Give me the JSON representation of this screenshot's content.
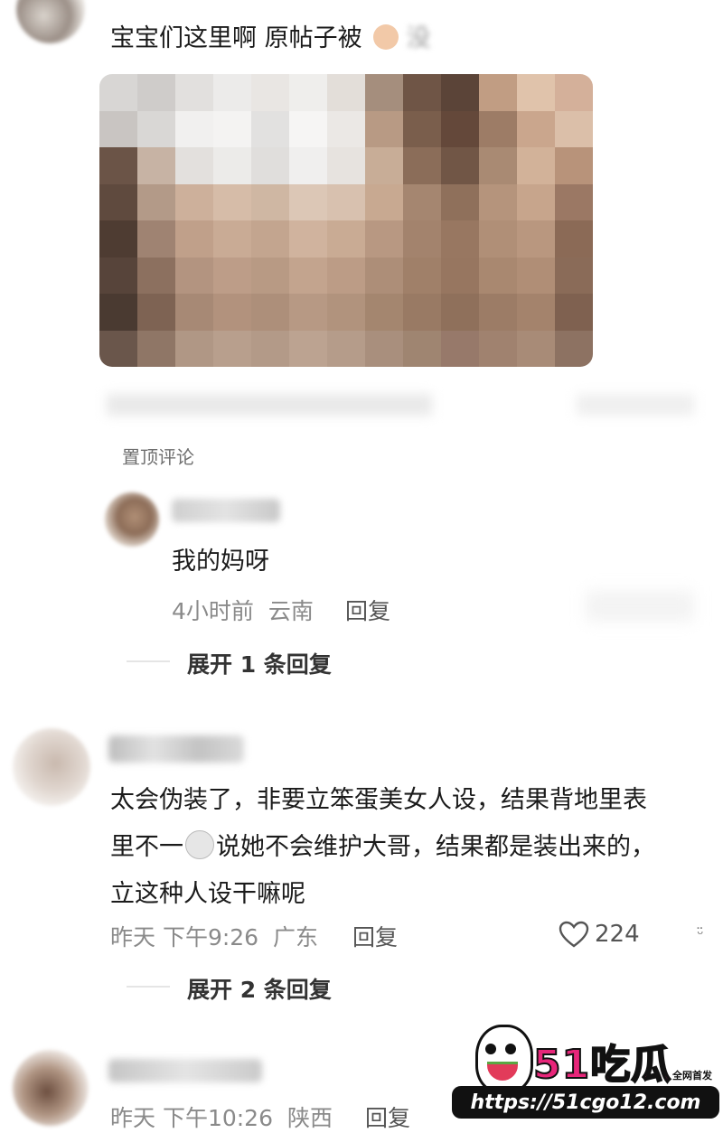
{
  "post": {
    "text": "宝宝们这里啊 原帖子被",
    "blurred_tail": "没",
    "colors": {
      "peach": "#f2c9a8"
    }
  },
  "pinned_label": "置顶评论",
  "comments": [
    {
      "text": "我的妈呀",
      "time": "4小时前",
      "location": "云南",
      "reply": "回复",
      "expand": "展开 1 条回复"
    },
    {
      "line1": "太会伪装了，非要立笨蛋美女人设，结果背地里表",
      "line2a": "里不一",
      "line2b": "说她不会维护大哥，结果都是装出来的，",
      "line3": "立这种人设干嘛呢",
      "time": "昨天 下午9:26",
      "location": "广东",
      "reply": "回复",
      "likes": "224",
      "expand": "展开 2 条回复"
    },
    {
      "time": "昨天 下午10:26",
      "location": "陕西",
      "reply": "回复"
    }
  ],
  "watermark": {
    "brand": "51吃瓜",
    "tag": "全网首发",
    "url": "https://51cgo12.com"
  }
}
